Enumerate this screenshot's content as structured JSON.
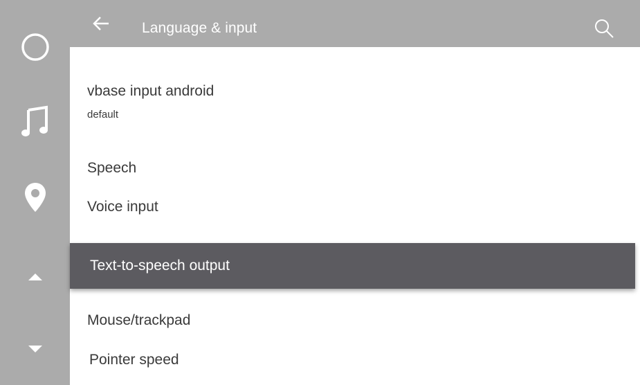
{
  "header": {
    "title": "Language & input",
    "back_icon": "arrow-left-icon",
    "search_icon": "search-icon"
  },
  "rail": {
    "icons": [
      "home-circle-icon",
      "music-note-icon",
      "location-pin-icon",
      "triangle-up-icon",
      "triangle-down-icon"
    ]
  },
  "list": {
    "keyboard_name": "vbase input android",
    "keyboard_sub": "default",
    "speech_header": "Speech",
    "voice_input": "Voice input",
    "tts_output": "Text-to-speech output",
    "mouse_header": "Mouse/trackpad",
    "pointer_speed": "Pointer speed"
  },
  "colors": {
    "bar": "#ababab",
    "selected": "#5c5b60",
    "text": "#3a3a3a",
    "white": "#ffffff"
  }
}
